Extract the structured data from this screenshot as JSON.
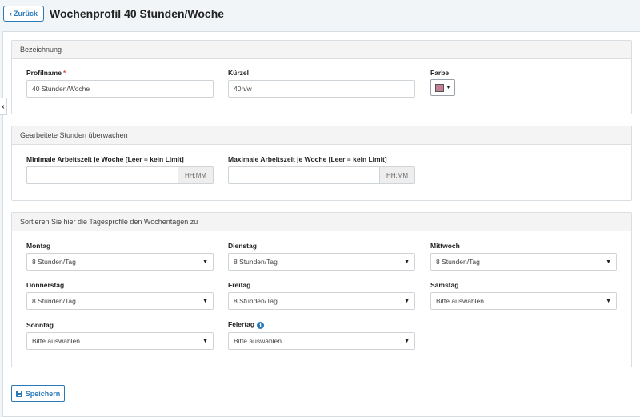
{
  "header": {
    "back_label": "Zurück",
    "title": "Wochenprofil 40 Stunden/Woche"
  },
  "bezeichnung": {
    "heading": "Bezeichnung",
    "profilname_label": "Profilname",
    "required_mark": "*",
    "profilname_value": "40 Stunden/Woche",
    "kuerzel_label": "Kürzel",
    "kuerzel_value": "40h/w",
    "farbe_label": "Farbe",
    "farbe_color": "#c1809a"
  },
  "stunden": {
    "heading": "Gearbeitete Stunden überwachen",
    "min_label": "Minimale Arbeitszeit je Woche [Leer = kein Limit]",
    "min_value": "",
    "max_label": "Maximale Arbeitszeit je Woche [Leer = kein Limit]",
    "max_value": "",
    "unit": "HH:MM"
  },
  "tage": {
    "heading": "Sortieren Sie hier die Tagesprofile den Wochentagen zu",
    "montag_label": "Montag",
    "montag_value": "8 Stunden/Tag",
    "dienstag_label": "Dienstag",
    "dienstag_value": "8 Stunden/Tag",
    "mittwoch_label": "Mittwoch",
    "mittwoch_value": "8 Stunden/Tag",
    "donnerstag_label": "Donnerstag",
    "donnerstag_value": "8 Stunden/Tag",
    "freitag_label": "Freitag",
    "freitag_value": "8 Stunden/Tag",
    "samstag_label": "Samstag",
    "samstag_value": "Bitte auswählen...",
    "sonntag_label": "Sonntag",
    "sonntag_value": "Bitte auswählen...",
    "feiertag_label": "Feiertag",
    "feiertag_value": "Bitte auswählen..."
  },
  "actions": {
    "save_label": "Speichern"
  },
  "icons": {
    "back": "chevron-left-icon",
    "collapse": "chevron-left-icon",
    "info": "info-icon",
    "save": "floppy-disk-icon",
    "dropdown": "caret-down-icon"
  },
  "colors": {
    "accent": "#2a7ab8",
    "required": "#d9534f"
  }
}
